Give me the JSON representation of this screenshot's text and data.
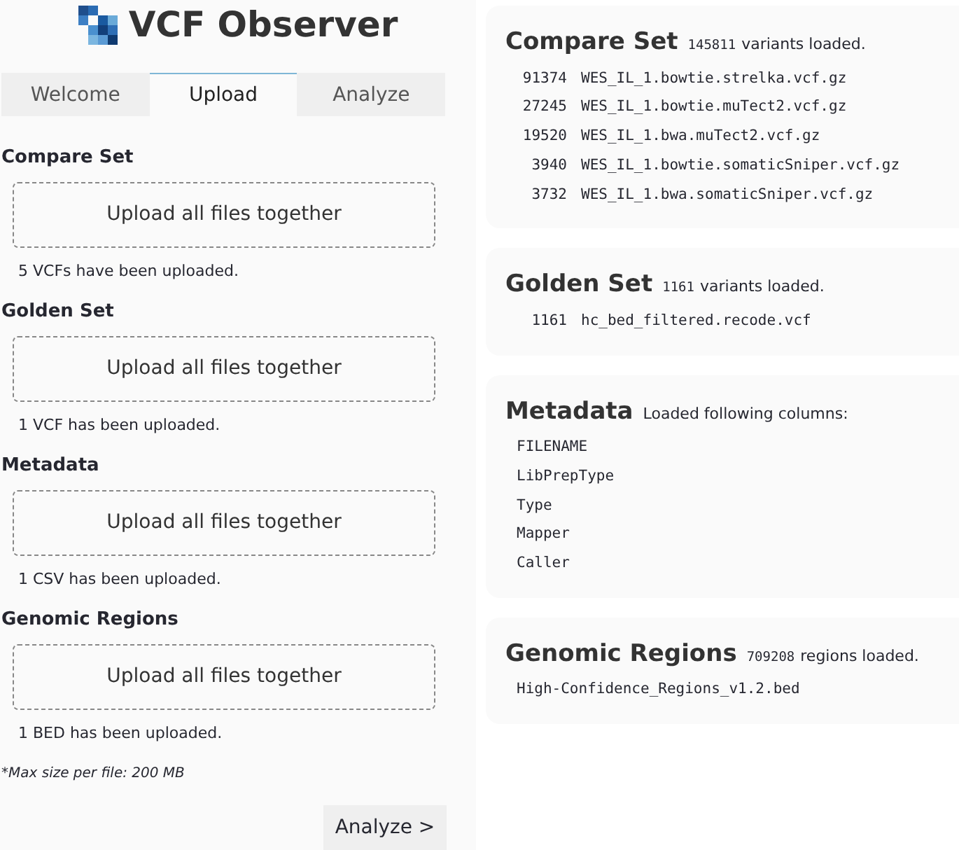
{
  "app": {
    "title": "VCF Observer"
  },
  "tabs": [
    {
      "label": "Welcome",
      "selected": false
    },
    {
      "label": "Upload",
      "selected": true
    },
    {
      "label": "Analyze",
      "selected": false
    }
  ],
  "upload_sections": [
    {
      "title": "Compare Set",
      "dropzone": "Upload all files together",
      "status": "5 VCFs have been uploaded."
    },
    {
      "title": "Golden Set",
      "dropzone": "Upload all files together",
      "status": "1 VCF has been uploaded."
    },
    {
      "title": "Metadata",
      "dropzone": "Upload all files together",
      "status": "1 CSV has been uploaded."
    },
    {
      "title": "Genomic Regions",
      "dropzone": "Upload all files together",
      "status": "1 BED has been uploaded."
    }
  ],
  "note": "*Max size per file: 200 MB",
  "analyze_button": "Analyze >",
  "summaries": [
    {
      "title": "Compare Set",
      "count": "145811",
      "caption": "variants loaded.",
      "lines": [
        {
          "count": "91374",
          "name": "WES_IL_1.bowtie.strelka.vcf.gz"
        },
        {
          "count": "27245",
          "name": "WES_IL_1.bowtie.muTect2.vcf.gz"
        },
        {
          "count": "19520",
          "name": "WES_IL_1.bwa.muTect2.vcf.gz"
        },
        {
          "count": "3940",
          "name": "WES_IL_1.bowtie.somaticSniper.vcf.gz"
        },
        {
          "count": "3732",
          "name": "WES_IL_1.bwa.somaticSniper.vcf.gz"
        }
      ]
    },
    {
      "title": "Golden Set",
      "count": "1161",
      "caption": "variants loaded.",
      "lines": [
        {
          "count": "1161",
          "name": "hc_bed_filtered.recode.vcf"
        }
      ]
    },
    {
      "title": "Metadata",
      "caption": "Loaded following columns:",
      "lines": [
        {
          "name": "FILENAME"
        },
        {
          "name": "LibPrepType"
        },
        {
          "name": "Type"
        },
        {
          "name": "Mapper"
        },
        {
          "name": "Caller"
        }
      ]
    },
    {
      "title": "Genomic Regions",
      "count": "709208",
      "caption": "regions loaded.",
      "lines": [
        {
          "name": "High-Confidence_Regions_v1.2.bed"
        }
      ]
    }
  ]
}
